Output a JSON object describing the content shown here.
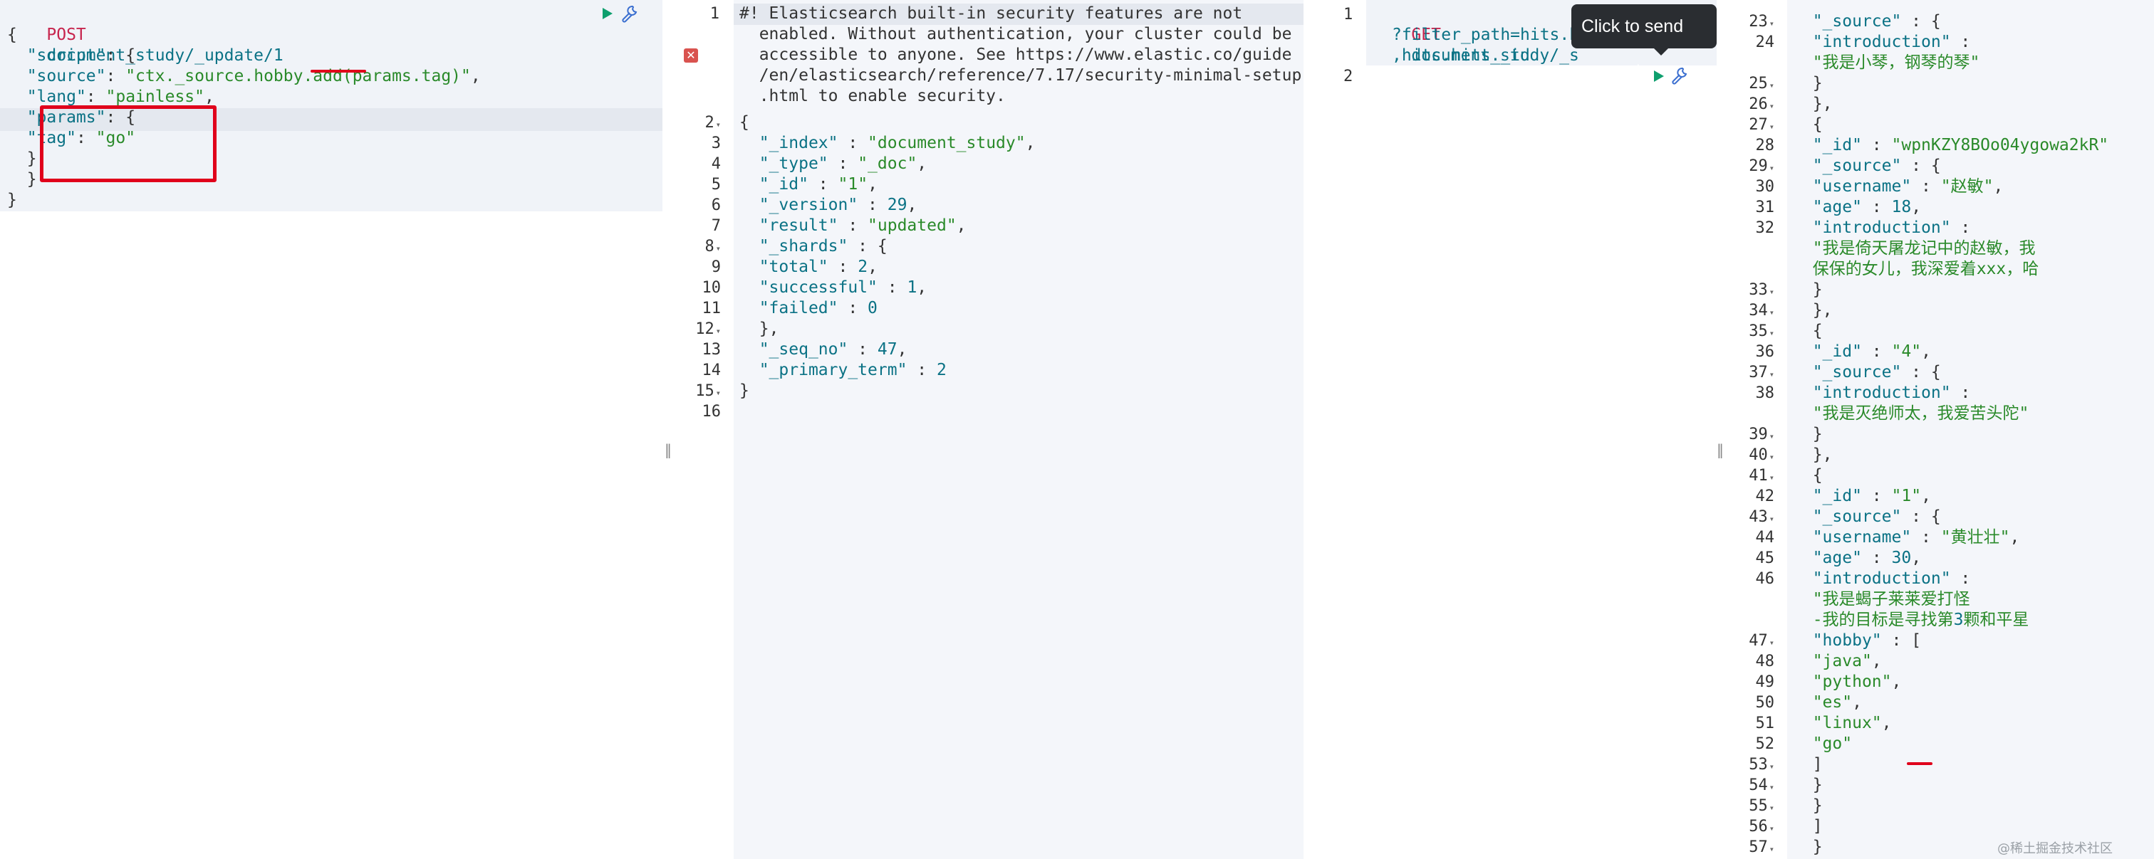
{
  "left_request": {
    "method": "POST",
    "url": "document_study/_update/1",
    "lines": [
      "{",
      "  \"script\": {",
      "    \"source\": \"ctx._source.hobby.add(params.tag)\",",
      "    \"lang\": \"painless\",",
      "    \"params\": {",
      "      \"tag\": \"go\"",
      "    }",
      "  }",
      "}"
    ]
  },
  "left_response": {
    "warning_lines": [
      "#! Elasticsearch built-in security features are not",
      "  enabled. Without authentication, your cluster could be",
      "  accessible to anyone. See https://www.elastic.co/guide",
      "  /en/elasticsearch/reference/7.17/security-minimal-setup",
      "  .html to enable security."
    ],
    "lines": [
      {
        "n": "2",
        "fold": true,
        "t": "{"
      },
      {
        "n": "3",
        "t": "  \"_index\" : \"document_study\","
      },
      {
        "n": "4",
        "t": "  \"_type\" : \"_doc\","
      },
      {
        "n": "5",
        "t": "  \"_id\" : \"1\","
      },
      {
        "n": "6",
        "t": "  \"_version\" : 29,"
      },
      {
        "n": "7",
        "t": "  \"result\" : \"updated\","
      },
      {
        "n": "8",
        "fold": true,
        "t": "  \"_shards\" : {"
      },
      {
        "n": "9",
        "t": "    \"total\" : 2,"
      },
      {
        "n": "10",
        "t": "    \"successful\" : 1,"
      },
      {
        "n": "11",
        "t": "    \"failed\" : 0"
      },
      {
        "n": "12",
        "fold": true,
        "t": "  },"
      },
      {
        "n": "13",
        "t": "  \"_seq_no\" : 47,"
      },
      {
        "n": "14",
        "t": "  \"_primary_term\" : 2"
      },
      {
        "n": "15",
        "fold": true,
        "t": "}"
      },
      {
        "n": "16",
        "t": ""
      }
    ]
  },
  "right_request": {
    "line1_num": "1",
    "line2_num": "2",
    "method": "GET",
    "url": "document_study/_s",
    "cont1": "?filter_path=hits.h",
    "cont2": ",hits.hits._id"
  },
  "tooltip": "Click to send request",
  "right_response": {
    "lines": [
      {
        "n": "23",
        "fold": true,
        "t": "        \"_source\" : {"
      },
      {
        "n": "24",
        "t": "          \"introduction\" :"
      },
      {
        "n": "",
        "t": "            \"我是小琴，钢琴的琴\""
      },
      {
        "n": "25",
        "fold": true,
        "t": "        }"
      },
      {
        "n": "26",
        "fold": true,
        "t": "      },"
      },
      {
        "n": "27",
        "fold": true,
        "t": "      {"
      },
      {
        "n": "28",
        "t": "        \"_id\" : \"wpnKZY8BOo04ygowa2kR\""
      },
      {
        "n": "29",
        "fold": true,
        "t": "        \"_source\" : {"
      },
      {
        "n": "30",
        "t": "          \"username\" : \"赵敏\","
      },
      {
        "n": "31",
        "t": "          \"age\" : 18,"
      },
      {
        "n": "32",
        "t": "          \"introduction\" :"
      },
      {
        "n": "",
        "t": "            \"我是倚天屠龙记中的赵敏，我"
      },
      {
        "n": "",
        "t": "            保保的女儿，我深爱着xxx，哈"
      },
      {
        "n": "33",
        "fold": true,
        "t": "        }"
      },
      {
        "n": "34",
        "fold": true,
        "t": "      },"
      },
      {
        "n": "35",
        "fold": true,
        "t": "      {"
      },
      {
        "n": "36",
        "t": "        \"_id\" : \"4\","
      },
      {
        "n": "37",
        "fold": true,
        "t": "        \"_source\" : {"
      },
      {
        "n": "38",
        "t": "          \"introduction\" :"
      },
      {
        "n": "",
        "t": "            \"我是灭绝师太，我爱苦头陀\""
      },
      {
        "n": "39",
        "fold": true,
        "t": "        }"
      },
      {
        "n": "40",
        "fold": true,
        "t": "      },"
      },
      {
        "n": "41",
        "fold": true,
        "t": "      {"
      },
      {
        "n": "42",
        "t": "        \"_id\" : \"1\","
      },
      {
        "n": "43",
        "fold": true,
        "t": "        \"_source\" : {"
      },
      {
        "n": "44",
        "t": "          \"username\" : \"黄壮壮\","
      },
      {
        "n": "45",
        "t": "          \"age\" : 30,"
      },
      {
        "n": "46",
        "t": "          \"introduction\" :"
      },
      {
        "n": "",
        "t": "            \"我是蝎子莱莱爱打怪"
      },
      {
        "n": "",
        "t": "            -我的目标是寻找第3颗和平星"
      },
      {
        "n": "47",
        "fold": true,
        "t": "          \"hobby\" : ["
      },
      {
        "n": "48",
        "t": "            \"java\","
      },
      {
        "n": "49",
        "t": "            \"python\","
      },
      {
        "n": "50",
        "t": "            \"es\","
      },
      {
        "n": "51",
        "t": "            \"linux\","
      },
      {
        "n": "52",
        "t": "            \"go\""
      },
      {
        "n": "53",
        "fold": true,
        "t": "          ]"
      },
      {
        "n": "54",
        "fold": true,
        "t": "        }"
      },
      {
        "n": "55",
        "fold": true,
        "t": "      }"
      },
      {
        "n": "56",
        "fold": true,
        "t": "    ]"
      },
      {
        "n": "57",
        "fold": true,
        "t": "  }"
      }
    ]
  },
  "watermark": "@稀土掘金技术社区",
  "resizer_glyph": "‖",
  "colors": {
    "method": "#c7254e",
    "key": "#0b7285",
    "string": "#2a8a2a",
    "play": "#0e9f6e",
    "annotation": "#e0001b"
  }
}
